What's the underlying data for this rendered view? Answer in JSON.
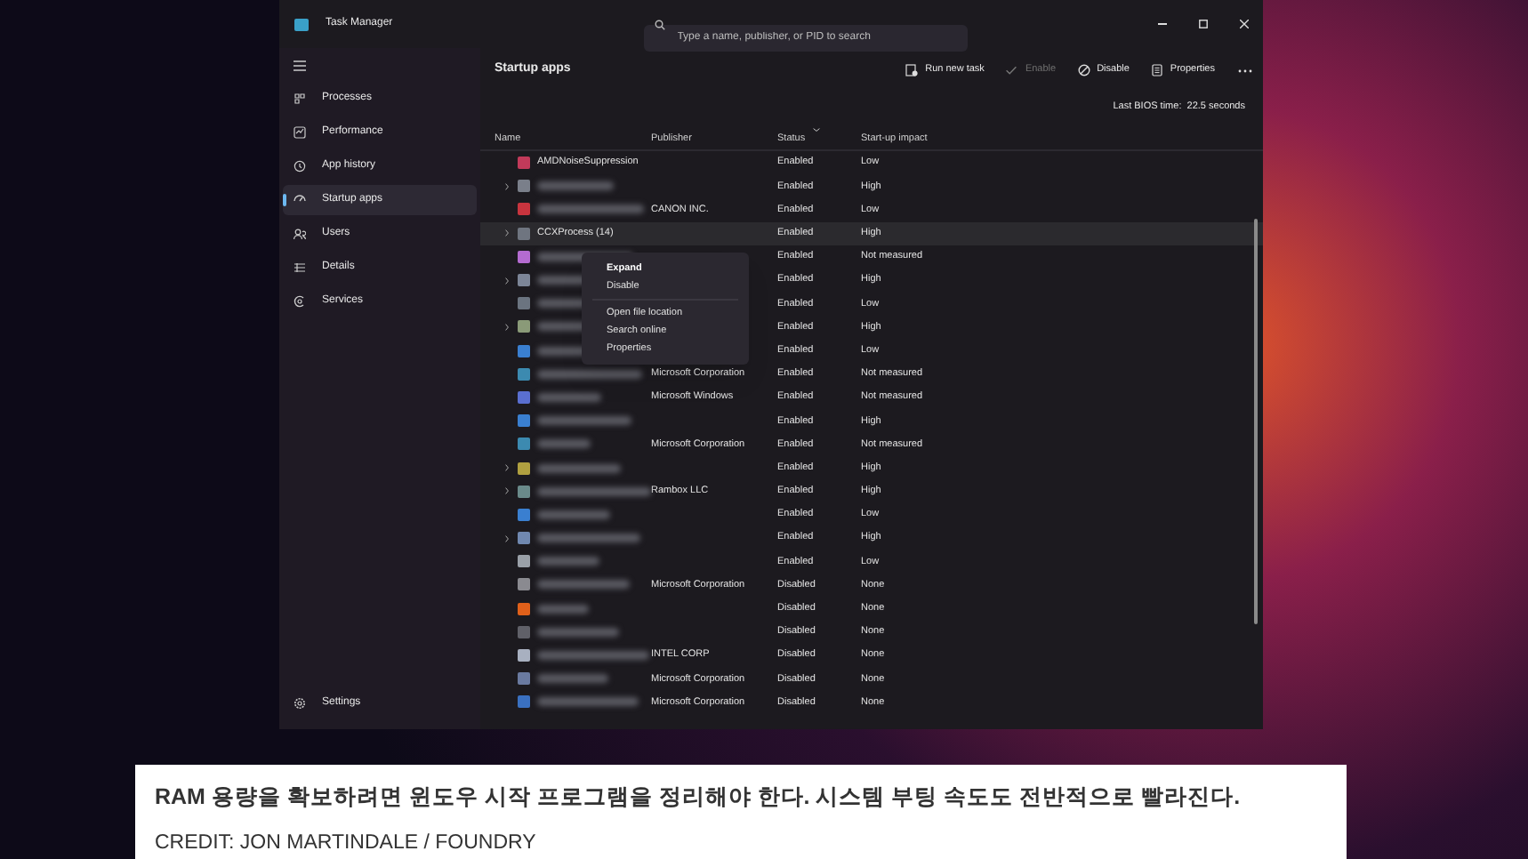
{
  "window": {
    "title": "Task Manager",
    "search": {
      "placeholder": "Type a name, publisher, or PID to search"
    }
  },
  "sidebar": {
    "items": [
      {
        "label": "Processes",
        "selected": false
      },
      {
        "label": "Performance",
        "selected": false
      },
      {
        "label": "App history",
        "selected": false
      },
      {
        "label": "Startup apps",
        "selected": true
      },
      {
        "label": "Users",
        "selected": false
      },
      {
        "label": "Details",
        "selected": false
      },
      {
        "label": "Services",
        "selected": false
      }
    ],
    "settings": "Settings"
  },
  "page": {
    "title": "Startup apps",
    "toolbar": [
      {
        "label": "Run new task",
        "disabled": false
      },
      {
        "label": "Enable",
        "disabled": true
      },
      {
        "label": "Disable",
        "disabled": false
      },
      {
        "label": "Properties",
        "disabled": false
      }
    ],
    "bios_time": "Last BIOS time:  22.5 seconds"
  },
  "table": {
    "columns": [
      "Name",
      "Publisher",
      "Status",
      "Start-up impact"
    ],
    "rows": [
      {
        "name": "AMDNoiseSuppression",
        "publisher": "",
        "status": "Enabled",
        "impact": "Low",
        "expandable": false,
        "selected": false
      },
      {
        "publisher": "",
        "status": "Enabled",
        "impact": "High",
        "expandable": true,
        "selected": false
      },
      {
        "publisher": "CANON INC.",
        "status": "Enabled",
        "impact": "Low",
        "expandable": false,
        "selected": false
      },
      {
        "name": "CCXProcess (14)",
        "publisher": "",
        "status": "Enabled",
        "impact": "High",
        "expandable": true,
        "selected": true
      },
      {
        "publisher": "",
        "status": "Enabled",
        "impact": "Not measured",
        "expandable": false,
        "selected": false
      },
      {
        "publisher": "",
        "status": "Enabled",
        "impact": "High",
        "expandable": true,
        "selected": false
      },
      {
        "publisher": "",
        "status": "Enabled",
        "impact": "Low",
        "expandable": false,
        "selected": false
      },
      {
        "publisher": "",
        "status": "Enabled",
        "impact": "High",
        "expandable": true,
        "selected": false
      },
      {
        "publisher": "",
        "status": "Enabled",
        "impact": "Low",
        "expandable": false,
        "selected": false
      },
      {
        "publisher": "Microsoft Corporation",
        "status": "Enabled",
        "impact": "Not measured",
        "expandable": false,
        "selected": false
      },
      {
        "publisher": "Microsoft Windows",
        "status": "Enabled",
        "impact": "Not measured",
        "expandable": false,
        "selected": false
      },
      {
        "publisher": "",
        "status": "Enabled",
        "impact": "High",
        "expandable": false,
        "selected": false
      },
      {
        "publisher": "Microsoft Corporation",
        "status": "Enabled",
        "impact": "Not measured",
        "expandable": false,
        "selected": false
      },
      {
        "publisher": "",
        "status": "Enabled",
        "impact": "High",
        "expandable": true,
        "selected": false
      },
      {
        "publisher": "Rambox LLC",
        "status": "Enabled",
        "impact": "High",
        "expandable": true,
        "selected": false
      },
      {
        "publisher": "",
        "status": "Enabled",
        "impact": "Low",
        "expandable": false,
        "selected": false
      },
      {
        "publisher": "",
        "status": "Enabled",
        "impact": "High",
        "expandable": true,
        "selected": false
      },
      {
        "publisher": "",
        "status": "Enabled",
        "impact": "Low",
        "expandable": false,
        "selected": false
      },
      {
        "publisher": "Microsoft Corporation",
        "status": "Disabled",
        "impact": "None",
        "expandable": false,
        "selected": false
      },
      {
        "publisher": "",
        "status": "Disabled",
        "impact": "None",
        "expandable": false,
        "selected": false
      },
      {
        "publisher": "",
        "status": "Disabled",
        "impact": "None",
        "expandable": false,
        "selected": false
      },
      {
        "publisher": "INTEL CORP",
        "status": "Disabled",
        "impact": "None",
        "expandable": false,
        "selected": false
      },
      {
        "publisher": "Microsoft Corporation",
        "status": "Disabled",
        "impact": "None",
        "expandable": false,
        "selected": false
      },
      {
        "publisher": "Microsoft Corporation",
        "status": "Disabled",
        "impact": "None",
        "expandable": false,
        "selected": false
      }
    ]
  },
  "context_menu": {
    "items": [
      {
        "label": "Expand",
        "bold": true,
        "separator_after": false
      },
      {
        "label": "Disable",
        "bold": false,
        "separator_after": true
      },
      {
        "label": "Open file location",
        "bold": false,
        "separator_after": false
      },
      {
        "label": "Search online",
        "bold": false,
        "separator_after": false
      },
      {
        "label": "Properties",
        "bold": false,
        "separator_after": false
      }
    ]
  },
  "caption": {
    "text": "RAM 용량을 확보하려면 윈도우 시작 프로그램을 정리해야 한다. 시스템 부팅 속도도 전반적으로 빨라진다.",
    "credit": "CREDIT: JON MARTINDALE / FOUNDRY"
  }
}
